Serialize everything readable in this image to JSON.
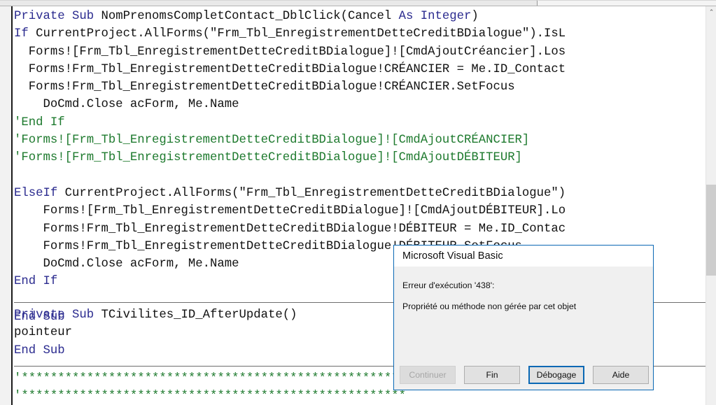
{
  "window": {
    "kind": "vba-code-editor",
    "scrollbar": {
      "up_arrow": "⌃"
    }
  },
  "code": {
    "blocks": [
      {
        "name": "procedure-nomprenomscompletcontact-dblclick",
        "lines": [
          [
            {
              "t": "Private Sub ",
              "c": "kw"
            },
            {
              "t": "NomPrenomsCompletContact_DblClick(Cancel ",
              "c": "plain"
            },
            {
              "t": "As ",
              "c": "kw"
            },
            {
              "t": "Integer",
              "c": "kw"
            },
            {
              "t": ")",
              "c": "plain"
            }
          ],
          [
            {
              "t": "If ",
              "c": "kw"
            },
            {
              "t": "CurrentProject.AllForms(\"Frm_Tbl_EnregistrementDetteCreditBDialogue\").IsL",
              "c": "plain"
            }
          ],
          [
            {
              "t": "  Forms![Frm_Tbl_EnregistrementDetteCreditBDialogue]![CmdAjoutCréancier].Los",
              "c": "plain"
            }
          ],
          [
            {
              "t": "  Forms!Frm_Tbl_EnregistrementDetteCreditBDialogue!CRÉANCIER = Me.ID_Contact",
              "c": "plain"
            }
          ],
          [
            {
              "t": "  Forms!Frm_Tbl_EnregistrementDetteCreditBDialogue!CRÉANCIER.SetFocus",
              "c": "plain"
            }
          ],
          [
            {
              "t": "    DoCmd.Close acForm, Me.Name",
              "c": "plain"
            }
          ],
          [
            {
              "t": "'End If",
              "c": "cmt"
            }
          ],
          [
            {
              "t": "'Forms![Frm_Tbl_EnregistrementDetteCreditBDialogue]![CmdAjoutCRÉANCIER]",
              "c": "cmt"
            }
          ],
          [
            {
              "t": "'Forms![Frm_Tbl_EnregistrementDetteCreditBDialogue]![CmdAjoutDÉBITEUR]",
              "c": "cmt"
            }
          ],
          [
            {
              "t": "",
              "c": "plain"
            }
          ],
          [
            {
              "t": "ElseIf ",
              "c": "kw"
            },
            {
              "t": "CurrentProject.AllForms(\"Frm_Tbl_EnregistrementDetteCreditBDialogue\")",
              "c": "plain"
            }
          ],
          [
            {
              "t": "    Forms![Frm_Tbl_EnregistrementDetteCreditBDialogue]![CmdAjoutDÉBITEUR].Lo",
              "c": "plain"
            }
          ],
          [
            {
              "t": "    Forms!Frm_Tbl_EnregistrementDetteCreditBDialogue!DÉBITEUR = Me.ID_Contac",
              "c": "plain"
            }
          ],
          [
            {
              "t": "    Forms!Frm_Tbl_EnregistrementDetteCreditBDialogue!DÉBITEUR.SetFocus",
              "c": "plain"
            }
          ],
          [
            {
              "t": "    DoCmd.Close acForm, Me.Name",
              "c": "plain"
            }
          ],
          [
            {
              "t": "End If",
              "c": "kw"
            }
          ],
          [
            {
              "t": "",
              "c": "plain"
            }
          ],
          [
            {
              "t": "End Sub",
              "c": "kw"
            }
          ]
        ]
      },
      {
        "name": "procedure-tcivilites-id-afterupdate",
        "lines": [
          [
            {
              "t": "Private Sub ",
              "c": "kw"
            },
            {
              "t": "TCivilites_ID_AfterUpdate()",
              "c": "plain"
            }
          ],
          [
            {
              "t": "pointeur",
              "c": "plain"
            }
          ],
          [
            {
              "t": "End Sub",
              "c": "kw"
            }
          ]
        ]
      },
      {
        "name": "comment-banner",
        "lines": [
          [
            {
              "t": "'*****************************************************",
              "c": "cmt"
            }
          ],
          [
            {
              "t": "'*****************************************************",
              "c": "cmt"
            }
          ]
        ]
      }
    ]
  },
  "dialog": {
    "title": "Microsoft Visual Basic",
    "message_line1": "Erreur d'exécution '438':",
    "message_line2": "Propriété ou méthode non gérée par cet objet",
    "buttons": [
      {
        "label": "Continuer",
        "state": "disabled"
      },
      {
        "label": "Fin",
        "state": "normal"
      },
      {
        "label": "Débogage",
        "state": "default"
      },
      {
        "label": "Aide",
        "state": "normal"
      }
    ],
    "colors": {
      "border": "#0a68b4",
      "titlebar": "#ffffff",
      "body": "#f0f0f0",
      "default_button_outline": "#0a68b4"
    }
  },
  "syntax_colors": {
    "keyword": "#2b2b8f",
    "plain": "#111111",
    "comment": "#1e7a2e"
  }
}
